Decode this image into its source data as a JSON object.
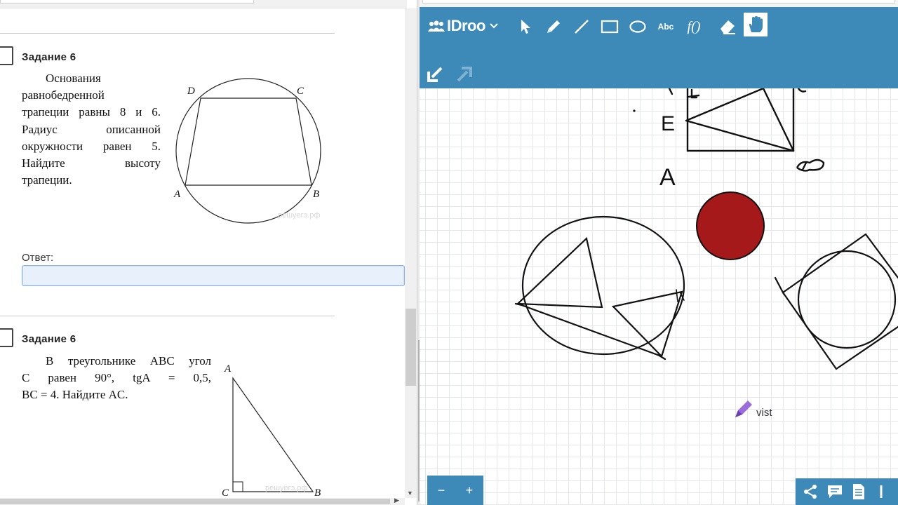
{
  "task1": {
    "title": "Задание 6",
    "text_lines": [
      "Основания",
      "равнобедренной",
      "трапеции равны 8 и 6.",
      "Радиус описанной",
      "окружности равен 5.",
      "Найдите высоту",
      "трапеции."
    ],
    "figure_labels": {
      "A": "A",
      "B": "B",
      "C": "C",
      "D": "D"
    },
    "watermark": "решуегэ.рф",
    "answer_label": "Ответ:",
    "answer_value": ""
  },
  "task2": {
    "title": "Задание 6",
    "text_lines": [
      "В треугольнике ABC угол",
      "C равен 90°, tgA = 0,5,",
      "BC = 4. Найдите AC."
    ],
    "figure_labels": {
      "A": "A",
      "B": "B",
      "C": "C"
    },
    "watermark": "решуегэ.рф"
  },
  "whiteboard": {
    "brand": "IDroo",
    "tools": [
      {
        "name": "select",
        "icon": "cursor-icon"
      },
      {
        "name": "pencil",
        "icon": "pencil-icon"
      },
      {
        "name": "line",
        "icon": "line-icon"
      },
      {
        "name": "rectangle",
        "icon": "rectangle-icon"
      },
      {
        "name": "ellipse",
        "icon": "ellipse-icon"
      },
      {
        "name": "text",
        "label": "Abc"
      },
      {
        "name": "formula",
        "label": "f()"
      },
      {
        "name": "eraser",
        "icon": "eraser-icon"
      },
      {
        "name": "hand",
        "icon": "hand-icon",
        "active": true
      }
    ],
    "canvas_labels": {
      "e_label": "E",
      "a_label": "A"
    },
    "cursor_user": "vist",
    "zoom_out": "−",
    "zoom_in": "+",
    "colors": {
      "toolbar": "#3d8ab9",
      "fill_circle": "#a5191b",
      "cursor_marker": "#9b6ddb",
      "grid": "#e3e6ea"
    }
  }
}
